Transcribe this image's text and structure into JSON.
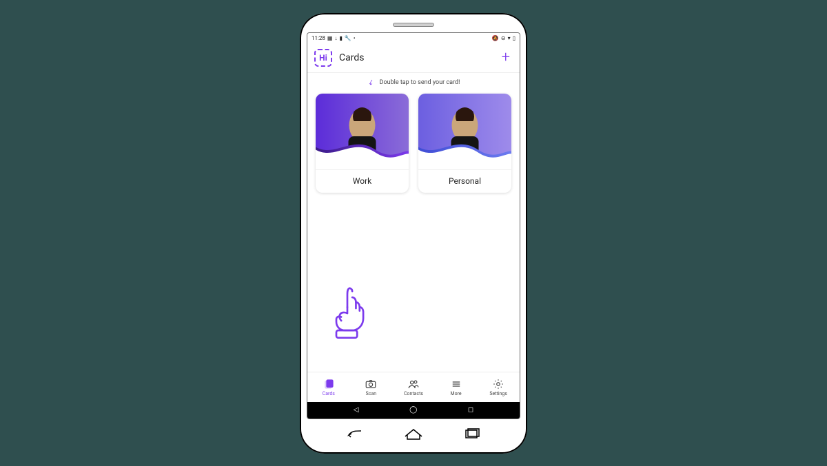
{
  "status_bar": {
    "time": "11:28",
    "left_icons": [
      "▦",
      "↓",
      "▮",
      "🔧",
      "•"
    ],
    "right_icons": [
      "🔕",
      "⊝",
      "▾",
      "▯"
    ]
  },
  "header": {
    "logo_text": "Hi",
    "title": "Cards"
  },
  "hint": {
    "text": "Double tap to send your card!"
  },
  "cards": [
    {
      "label": "Work"
    },
    {
      "label": "Personal"
    }
  ],
  "tabs": [
    {
      "label": "Cards",
      "active": true
    },
    {
      "label": "Scan",
      "active": false
    },
    {
      "label": "Contacts",
      "active": false
    },
    {
      "label": "More",
      "active": false
    },
    {
      "label": "Settings",
      "active": false
    }
  ],
  "colors": {
    "accent": "#7c3aed"
  }
}
